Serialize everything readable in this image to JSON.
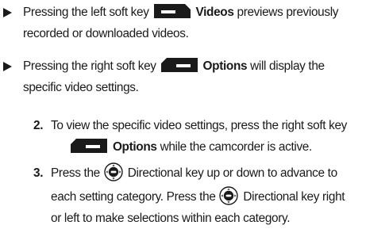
{
  "bullets": [
    {
      "line1_pre": "Pressing the left soft key",
      "key_label": "Videos",
      "line1_post": "previews previously",
      "line2": "recorded or downloaded videos."
    },
    {
      "line1_pre": "Pressing the right soft key",
      "key_label": "Options",
      "line1_post": "will display the",
      "line2": "specific video settings."
    }
  ],
  "steps": [
    {
      "number": "2.",
      "line1": "To view the specific video settings, press the right soft key",
      "key_label": "Options",
      "line2_post": "while the camcorder is active."
    },
    {
      "number": "3.",
      "line1_pre": "Press the",
      "line1_post": "Directional key up or down to advance to",
      "line2_pre": "each setting category. Press the",
      "line2_post": "Directional key right",
      "line3": "or left to make selections within each category."
    }
  ],
  "icons": {
    "left_soft_key": "left-soft-key-icon",
    "right_soft_key": "right-soft-key-icon",
    "directional_key": "directional-key-icon"
  },
  "colors": {
    "text": "#1a1a1a",
    "icon": "#1a1a1a",
    "icon_bar": "#ffffff"
  }
}
